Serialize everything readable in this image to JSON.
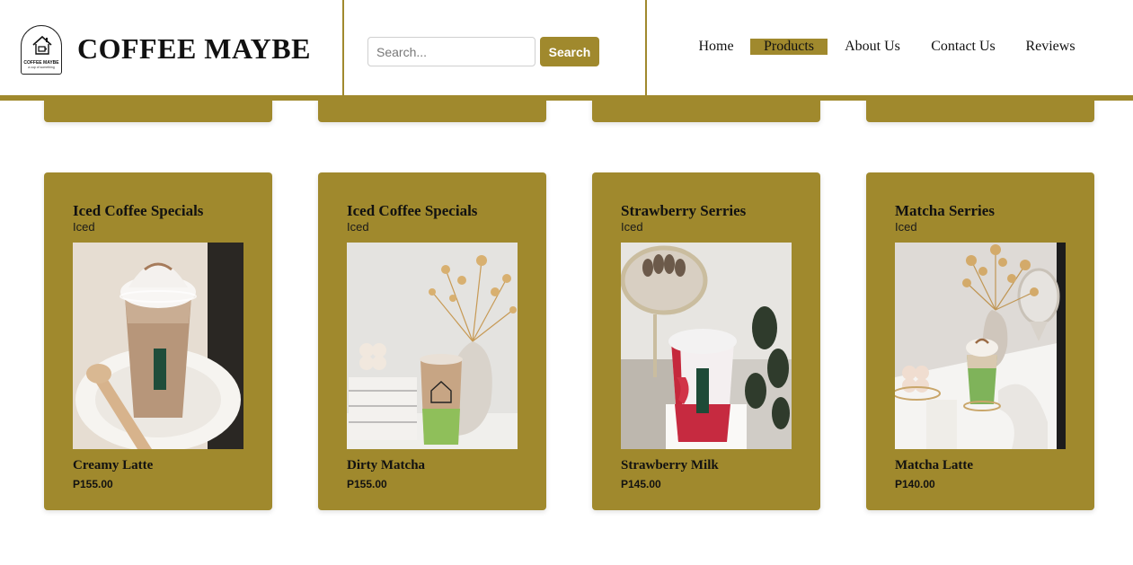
{
  "header": {
    "logo": {
      "text": "COFFEE MAYBE",
      "subtext": "a cup of something",
      "icon": "house-cup-logo-icon"
    },
    "brand": "COFFEE MAYBE",
    "search": {
      "placeholder": "Search...",
      "value": "",
      "button_label": "Search"
    },
    "nav": [
      {
        "label": "Home",
        "active": false
      },
      {
        "label": "Products",
        "active": true
      },
      {
        "label": "About Us",
        "active": false
      },
      {
        "label": "Contact Us",
        "active": false
      },
      {
        "label": "Reviews",
        "active": false
      }
    ]
  },
  "products": [
    {
      "category": "Iced Coffee Specials",
      "type": "Iced",
      "name": "Creamy Latte",
      "price": "P155.00"
    },
    {
      "category": "Iced Coffee Specials",
      "type": "Iced",
      "name": "Dirty Matcha",
      "price": "P155.00"
    },
    {
      "category": "Strawberry Serries",
      "type": "Iced",
      "name": "Strawberry Milk",
      "price": "P145.00"
    },
    {
      "category": "Matcha Serries",
      "type": "Iced",
      "name": "Matcha Latte",
      "price": "P140.00"
    }
  ],
  "colors": {
    "accent": "#a0892d",
    "background": "#ffffff",
    "text": "#111111"
  }
}
